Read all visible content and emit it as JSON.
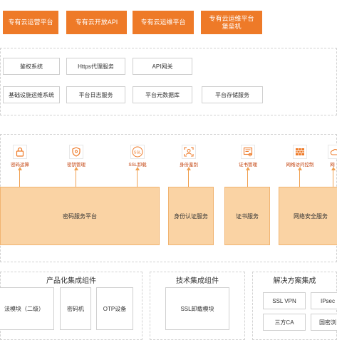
{
  "top_row": [
    "专有云运营平台",
    "专有云开放API",
    "专有云运维平台",
    "专有云运维平台\n堡垒机"
  ],
  "services_row1": [
    "鉴权系统",
    "Https代理服务",
    "API网关"
  ],
  "services_row2": [
    "基础设施运维系统",
    "平台日志服务",
    "平台元数据库",
    "平台存储服务"
  ],
  "icons": [
    {
      "icon": "lock-icon",
      "label": "密码运算"
    },
    {
      "icon": "shield-key-icon",
      "label": "密钥管理"
    },
    {
      "icon": "ssl-icon",
      "label": "SSL卸载"
    },
    {
      "icon": "id-scan-icon",
      "label": "身份鉴别"
    },
    {
      "icon": "certificate-icon",
      "label": "证书管理"
    },
    {
      "icon": "firewall-icon",
      "label": "网络访问控制"
    },
    {
      "icon": "cloud-icon",
      "label": "网"
    }
  ],
  "units": [
    "密码服务平台",
    "身份认证服务",
    "证书服务",
    "网络安全服务"
  ],
  "sections": [
    {
      "title": "产品化集成组件",
      "items": [
        "法模块（二级）",
        "密码机",
        "OTP设备"
      ]
    },
    {
      "title": "技术集成组件",
      "items": [
        "SSL卸载模块"
      ]
    },
    {
      "title": "解决方案集成",
      "items": [
        "SSL VPN",
        "IPsec",
        "三方CA",
        "国密浏"
      ]
    }
  ],
  "colors": {
    "accent": "#ee7a28",
    "light_accent": "#fad3a4"
  }
}
